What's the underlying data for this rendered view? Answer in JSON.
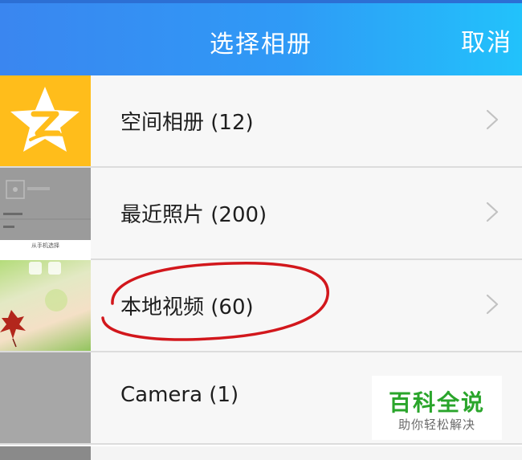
{
  "header": {
    "title": "选择相册",
    "cancel_label": "取消"
  },
  "albums": [
    {
      "label": "空间相册 (12)",
      "thumb_icon": "qq-zone-star-icon"
    },
    {
      "label": "最近照片 (200)",
      "thumb_icon": "recent-screenshot-thumbnail",
      "thumb_caption": "从手机选择"
    },
    {
      "label": "本地视频 (60)",
      "thumb_icon": "maple-leaf-thumbnail"
    },
    {
      "label": "Camera (1)",
      "thumb_icon": "camera-thumbnail"
    }
  ],
  "watermark": {
    "title": "百科全说",
    "subtitle": "助你轻松解决"
  },
  "colors": {
    "header_start": "#3a86f0",
    "header_end": "#22c2fb",
    "annotation_red": "#d2171c",
    "watermark_green": "#2aa52b"
  }
}
